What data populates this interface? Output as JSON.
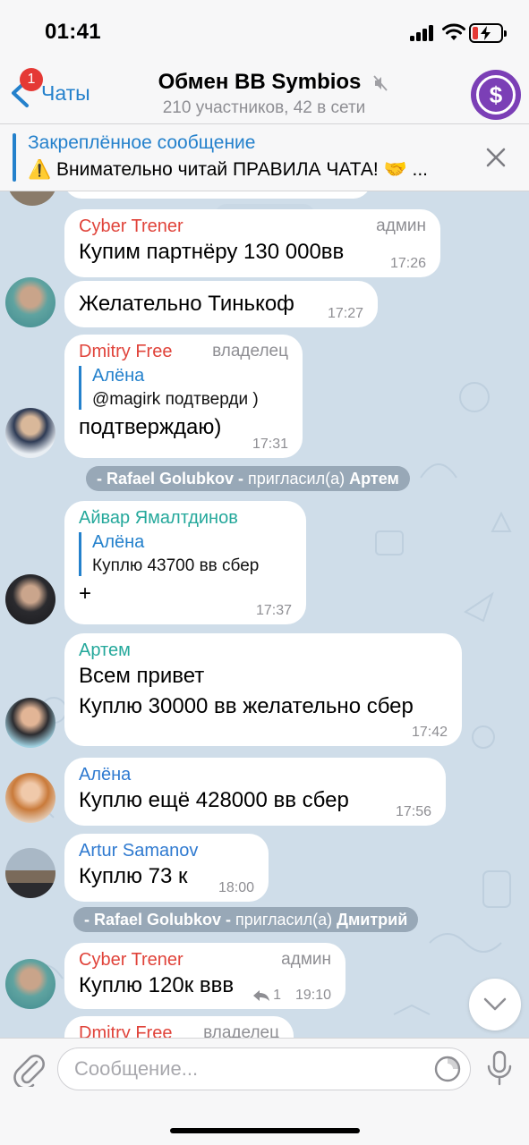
{
  "status_bar": {
    "time": "01:41",
    "battery_level": 0.2
  },
  "header": {
    "back_label": "Чаты",
    "unread_count": "1",
    "title": "Обмен ВВ Symbios",
    "subtitle": "210 участников, 42 в сети",
    "avatar_symbol": "$",
    "avatar_color": "#7b3fb6"
  },
  "pinned": {
    "title": "Закреплённое сообщение",
    "text": "⚠️ Внимательно читай ПРАВИЛА ЧАТА! 🤝 ..."
  },
  "messages": [
    {
      "sender": "Cyber Trener",
      "sender_color": "#e0433a",
      "role": "админ",
      "text": "Купим партнёру 130 000вв",
      "time": "17:26"
    },
    {
      "text": "Желательно Тинькоф",
      "time": "17:27"
    },
    {
      "sender": "Dmitry Free",
      "sender_color": "#e0433a",
      "role": "владелец",
      "reply": {
        "name": "Алёна",
        "text": "@magirk подтверди )"
      },
      "text": "подтверждаю)",
      "time": "17:31"
    },
    {
      "sender": "Айвар Ямалтдинов",
      "sender_color": "#24a89b",
      "reply": {
        "name": "Алёна",
        "text": "Куплю 43700 вв сбер"
      },
      "text": "+",
      "time": "17:37"
    },
    {
      "sender": "Артем",
      "sender_color": "#24a89b",
      "lines": [
        "Всем привет",
        "Куплю 30000 вв желательно сбер"
      ],
      "time": "17:42"
    },
    {
      "sender": "Алёна",
      "sender_color": "#2f7ad0",
      "text": "Куплю ещё 428000 вв сбер",
      "time": "17:56"
    },
    {
      "sender": "Artur Samanov",
      "sender_color": "#2f7ad0",
      "text": "Куплю 73 к",
      "time": "18:00"
    },
    {
      "sender": "Cyber Trener",
      "sender_color": "#e0433a",
      "role": "админ",
      "text": "Куплю 120к ввв",
      "time": "19:10",
      "reply_count": "1"
    },
    {
      "sender": "Dmitry Free",
      "sender_color": "#e0433a",
      "role": "владелец"
    }
  ],
  "service_messages": [
    {
      "actor": "- Rafael Golubkov -",
      "action": "пригласил(а)",
      "target": "Артем"
    },
    {
      "actor": "- Rafael Golubkov -",
      "action": "пригласил(а)",
      "target": "Дмитрий"
    }
  ],
  "input": {
    "placeholder": "Сообщение..."
  }
}
